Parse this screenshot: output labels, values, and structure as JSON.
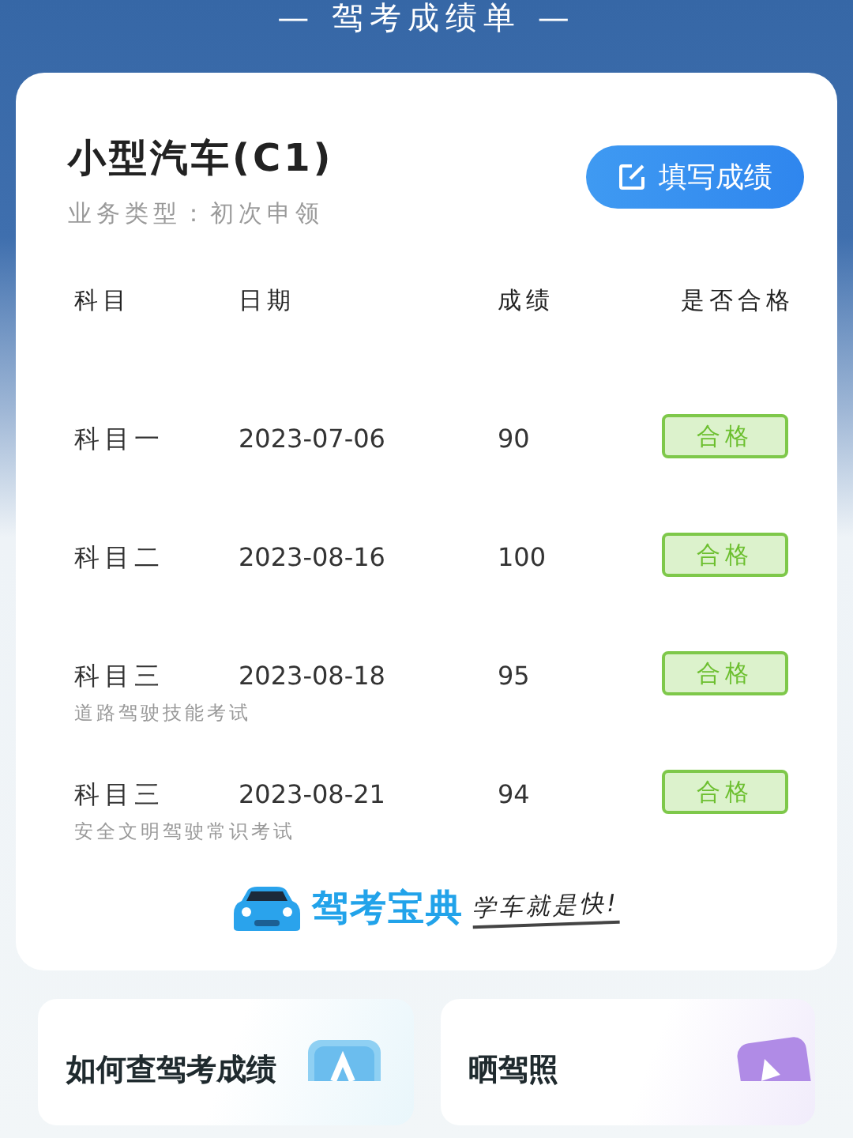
{
  "header": {
    "title": "— 驾考成绩单 —"
  },
  "card": {
    "license": "小型汽车(C1)",
    "business_type": "业务类型：初次申领",
    "button": "填写成绩",
    "columns": [
      "科目",
      "日期",
      "成绩",
      "是否合格"
    ],
    "rows": [
      {
        "subject": "科目一",
        "note": null,
        "date": "2023-07-06",
        "score": "90",
        "result": "合格",
        "passed": true
      },
      {
        "subject": "科目二",
        "note": null,
        "date": "2023-08-16",
        "score": "100",
        "result": "合格",
        "passed": true
      },
      {
        "subject": "科目三",
        "note": "道路驾驶技能考试",
        "date": "2023-08-18",
        "score": "95",
        "result": "合格",
        "passed": true
      },
      {
        "subject": "科目三",
        "note": "安全文明驾驶常识考试",
        "date": "2023-08-21",
        "score": "94",
        "result": "合格",
        "passed": true
      }
    ],
    "brand": {
      "name": "驾考宝典",
      "slogan": "学车就是快!"
    }
  },
  "links": [
    {
      "title": "如何查驾考成绩",
      "kind": "document"
    },
    {
      "title": "晒驾照",
      "kind": "photo"
    }
  ]
}
